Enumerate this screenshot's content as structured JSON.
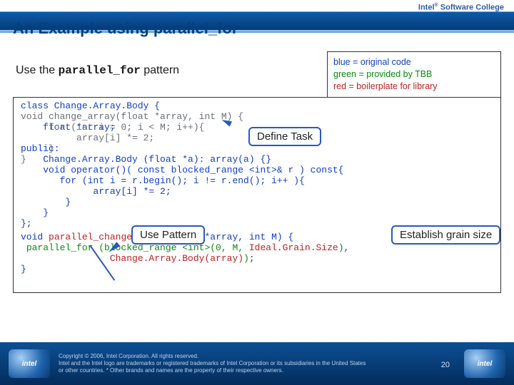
{
  "brand": {
    "text_html": "Intel<sup>®</sup> Software College"
  },
  "title": "An Example using parallel_for",
  "subtitle": {
    "pre": "Use the ",
    "code": "parallel_for",
    "post": " pattern"
  },
  "legend": {
    "blue": "blue = original code",
    "green": "green = provided by TBB",
    "red": "red = boilerplate for library"
  },
  "callouts": {
    "define_task": "Define Task",
    "use_pattern": "Use Pattern",
    "establish": "Establish grain size"
  },
  "code_layers": {
    "gray_top_lines": "\nvoid change_array(float *array, int M) {\n     for (int i = 0; i < M; i++){\n          array[i] *= 2;\n     }\n}",
    "blue_block": "class Change.Array.Body {\n\n    float *array;\n\npublic:\n    Change.Array.Body (float *a): array(a) {}\n    void operator()( const blocked_range <int>& r ) const{\n       for (int i = r.begin(); i != r.end(); i++ ){\n             array[i] *= 2;\n        }\n    }\n};",
    "bottom_html": "<span class=\"bl\">void</span> <span class=\"redc\">parallel_change_array</span><span class=\"bl\">(float *array, int M) {</span>\n <span class=\"grn\">parallel_for (blocked_range &lt;int&gt;(0, M,</span> <span class=\"redc\">Ideal.Grain.Size</span><span class=\"grn\">)</span><span class=\"bl\">,</span>\n                <span class=\"redc\">Change.Array.Body(array)</span><span class=\"grn\">)</span><span class=\"bl\">;</span>\n<span class=\"bl\">}</span>"
  },
  "footer": {
    "copyright": "Copyright © 2006, Intel Corporation. All rights reserved.\nIntel and the Intel logo are trademarks or registered trademarks of Intel Corporation or its subsidiaries in the United States\nor other countries. * Other brands and names are the property of their respective owners.",
    "page": "20",
    "chip_left": "intel",
    "chip_right": "intel"
  }
}
